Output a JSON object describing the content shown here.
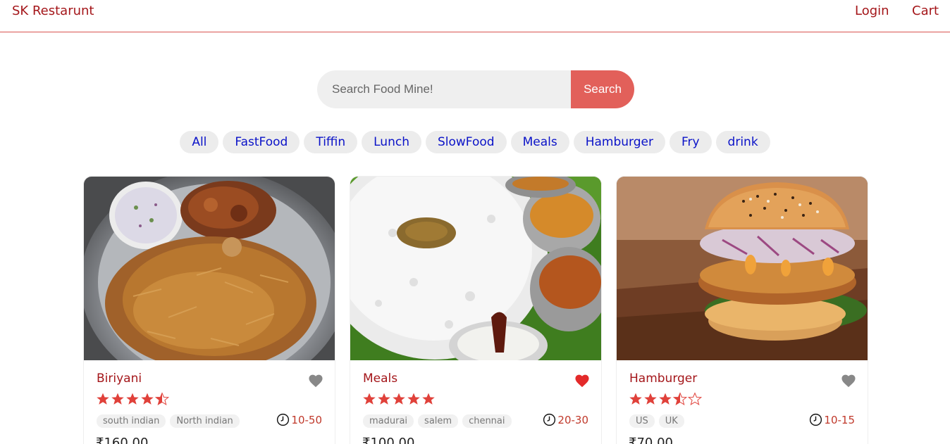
{
  "header": {
    "logo": "SK Restarunt",
    "login": "Login",
    "cart": "Cart"
  },
  "search": {
    "placeholder": "Search Food Mine!",
    "button": "Search"
  },
  "tags": [
    "All",
    "FastFood",
    "Tiffin",
    "Lunch",
    "SlowFood",
    "Meals",
    "Hamburger",
    "Fry",
    "drink"
  ],
  "foods": [
    {
      "name": "Biriyani",
      "rating": 4.5,
      "favorite": false,
      "origins": [
        "south indian",
        "North indian"
      ],
      "cook_time": "10-50",
      "price": "₹160.00"
    },
    {
      "name": "Meals",
      "rating": 5,
      "favorite": true,
      "origins": [
        "madurai",
        "salem",
        "chennai"
      ],
      "cook_time": "20-30",
      "price": "₹100.00"
    },
    {
      "name": "Hamburger",
      "rating": 3.5,
      "favorite": false,
      "origins": [
        "US",
        "UK"
      ],
      "cook_time": "10-15",
      "price": "₹70.00"
    }
  ],
  "colors": {
    "accent": "#e2605a",
    "brand": "#a4161a",
    "tag_text": "#0a12c8",
    "star": "#e0413a",
    "heart_active": "#e32a2a",
    "heart_inactive": "#888888"
  },
  "icons": {
    "favorite": "heart-icon",
    "rating": "star-icon",
    "time": "clock-icon"
  }
}
